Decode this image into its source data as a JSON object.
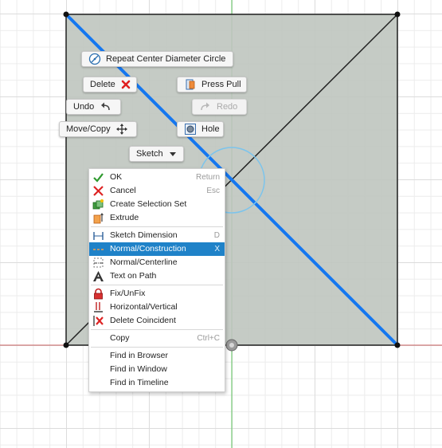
{
  "marking_menu": {
    "repeat": {
      "label": "Repeat Center Diameter Circle",
      "icon": "circle-diameter-icon"
    },
    "delete": {
      "label": "Delete",
      "icon": "red-x-icon"
    },
    "press_pull": {
      "label": "Press Pull",
      "icon": "press-pull-icon"
    },
    "undo": {
      "label": "Undo",
      "icon": "undo-arrow-icon"
    },
    "redo": {
      "label": "Redo",
      "icon": "redo-arrow-icon",
      "disabled": true
    },
    "move_copy": {
      "label": "Move/Copy",
      "icon": "move-arrows-icon"
    },
    "hole": {
      "label": "Hole",
      "icon": "hole-icon"
    },
    "sketch": {
      "label": "Sketch",
      "icon": "dropdown-triangle-icon"
    }
  },
  "context_menu": {
    "groups": [
      [
        {
          "label": "OK",
          "shortcut": "Return",
          "icon": "check-icon"
        },
        {
          "label": "Cancel",
          "shortcut": "Esc",
          "icon": "cancel-x-icon"
        },
        {
          "label": "Create Selection Set",
          "shortcut": "",
          "icon": "selection-set-icon"
        },
        {
          "label": "Extrude",
          "shortcut": "",
          "icon": "extrude-icon"
        }
      ],
      [
        {
          "label": "Sketch Dimension",
          "shortcut": "D",
          "icon": "dimension-icon"
        },
        {
          "label": "Normal/Construction",
          "shortcut": "X",
          "icon": "construction-line-icon",
          "highlighted": true
        },
        {
          "label": "Normal/Centerline",
          "shortcut": "",
          "icon": "centerline-icon"
        },
        {
          "label": "Text on Path",
          "shortcut": "",
          "icon": "text-a-icon"
        }
      ],
      [
        {
          "label": "Fix/UnFix",
          "shortcut": "",
          "icon": "lock-icon"
        },
        {
          "label": "Horizontal/Vertical",
          "shortcut": "",
          "icon": "horizontal-vertical-icon"
        },
        {
          "label": "Delete Coincident",
          "shortcut": "",
          "icon": "delete-coincident-icon"
        }
      ],
      [
        {
          "label": "Copy",
          "shortcut": "Ctrl+C",
          "icon": ""
        }
      ],
      [
        {
          "label": "Find in Browser",
          "shortcut": "",
          "icon": ""
        },
        {
          "label": "Find in Window",
          "shortcut": "",
          "icon": ""
        },
        {
          "label": "Find in Timeline",
          "shortcut": "",
          "icon": ""
        }
      ]
    ]
  },
  "colors": {
    "face": "#bfc5bf",
    "selected_line": "#1577f0",
    "highlight": "#1f82c8",
    "x_axis": "#c96060",
    "y_axis": "#5fc45f",
    "circle": "#7cc4ec"
  }
}
